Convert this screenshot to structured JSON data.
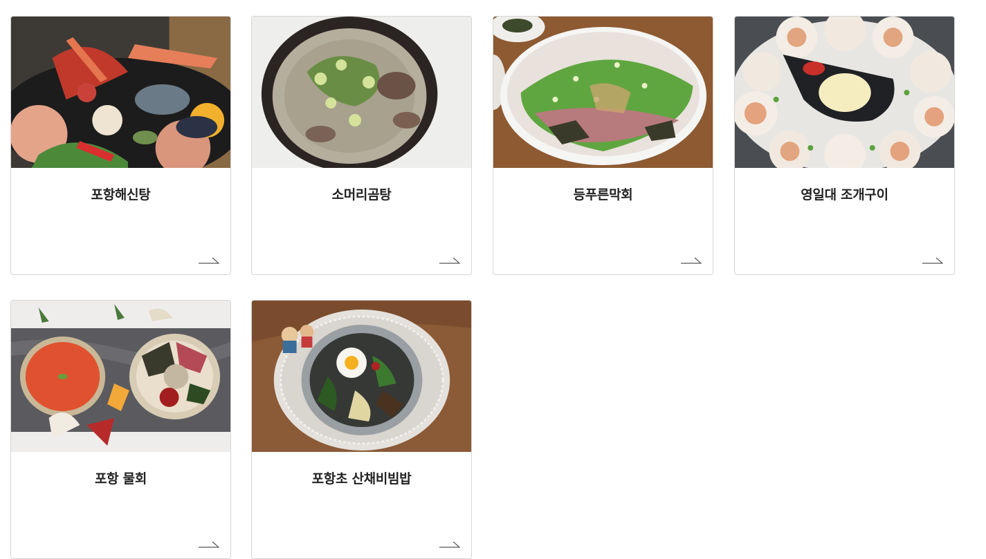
{
  "cards": [
    {
      "title": "포항해신탕",
      "image": "seafood-hotpot-photo",
      "arrow_icon": "arrow-right-icon"
    },
    {
      "title": "소머리곰탕",
      "image": "beef-head-soup-photo",
      "arrow_icon": "arrow-right-icon"
    },
    {
      "title": "등푸른막회",
      "image": "sliced-raw-fish-photo",
      "arrow_icon": "arrow-right-icon"
    },
    {
      "title": "영일대 조개구이",
      "image": "grilled-scallops-photo",
      "arrow_icon": "arrow-right-icon"
    },
    {
      "title": "포항 물회",
      "image": "cold-raw-fish-soup-photo",
      "arrow_icon": "arrow-right-icon"
    },
    {
      "title": "포항초 산채비빔밥",
      "image": "vegetable-bibimbap-photo",
      "arrow_icon": "arrow-right-icon"
    }
  ],
  "colors": {
    "border": "#d5d5d5",
    "title_text": "#222222",
    "arrow": "#555555"
  }
}
